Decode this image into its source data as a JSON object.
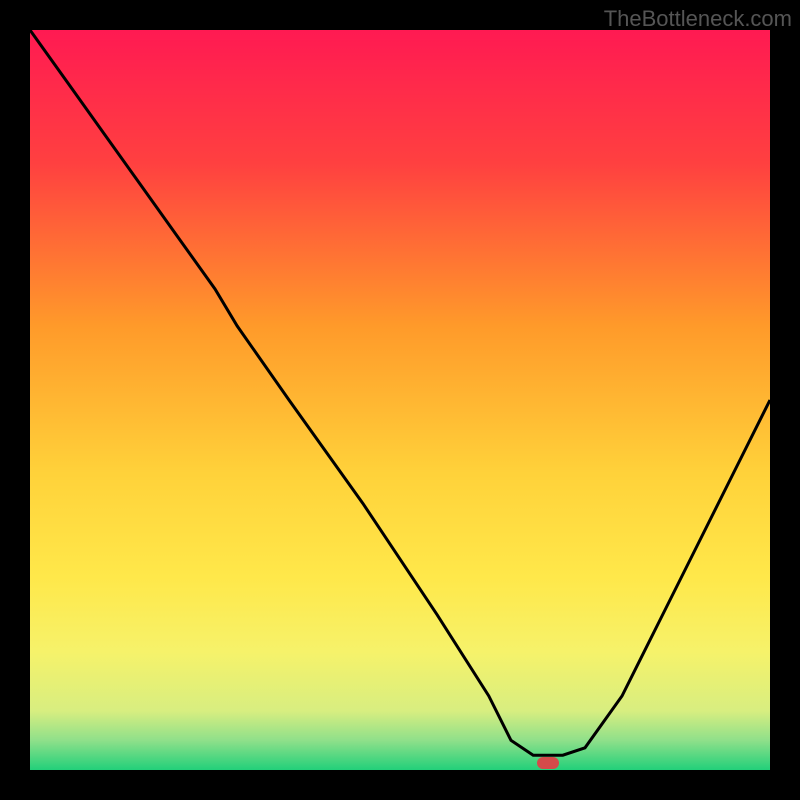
{
  "watermark": "TheBottleneck.com",
  "chart_data": {
    "type": "line",
    "title": "",
    "xlabel": "",
    "ylabel": "",
    "xlim": [
      0,
      100
    ],
    "ylim": [
      0,
      100
    ],
    "x": [
      0,
      5,
      10,
      15,
      20,
      25,
      28,
      35,
      45,
      55,
      62,
      65,
      68,
      72,
      75,
      80,
      85,
      90,
      95,
      100
    ],
    "values": [
      100,
      93,
      86,
      79,
      72,
      65,
      60,
      50,
      36,
      21,
      10,
      4,
      2,
      2,
      3,
      10,
      20,
      30,
      40,
      50
    ],
    "marker": {
      "x": 70,
      "y": 1
    },
    "gradient_stops": [
      {
        "offset": 0.0,
        "color": "#ff1a52"
      },
      {
        "offset": 0.18,
        "color": "#ff4040"
      },
      {
        "offset": 0.4,
        "color": "#ff9a2a"
      },
      {
        "offset": 0.6,
        "color": "#ffd23a"
      },
      {
        "offset": 0.74,
        "color": "#ffe84a"
      },
      {
        "offset": 0.84,
        "color": "#f6f26a"
      },
      {
        "offset": 0.92,
        "color": "#d8ee80"
      },
      {
        "offset": 0.96,
        "color": "#8fe08a"
      },
      {
        "offset": 1.0,
        "color": "#22d07a"
      }
    ]
  }
}
